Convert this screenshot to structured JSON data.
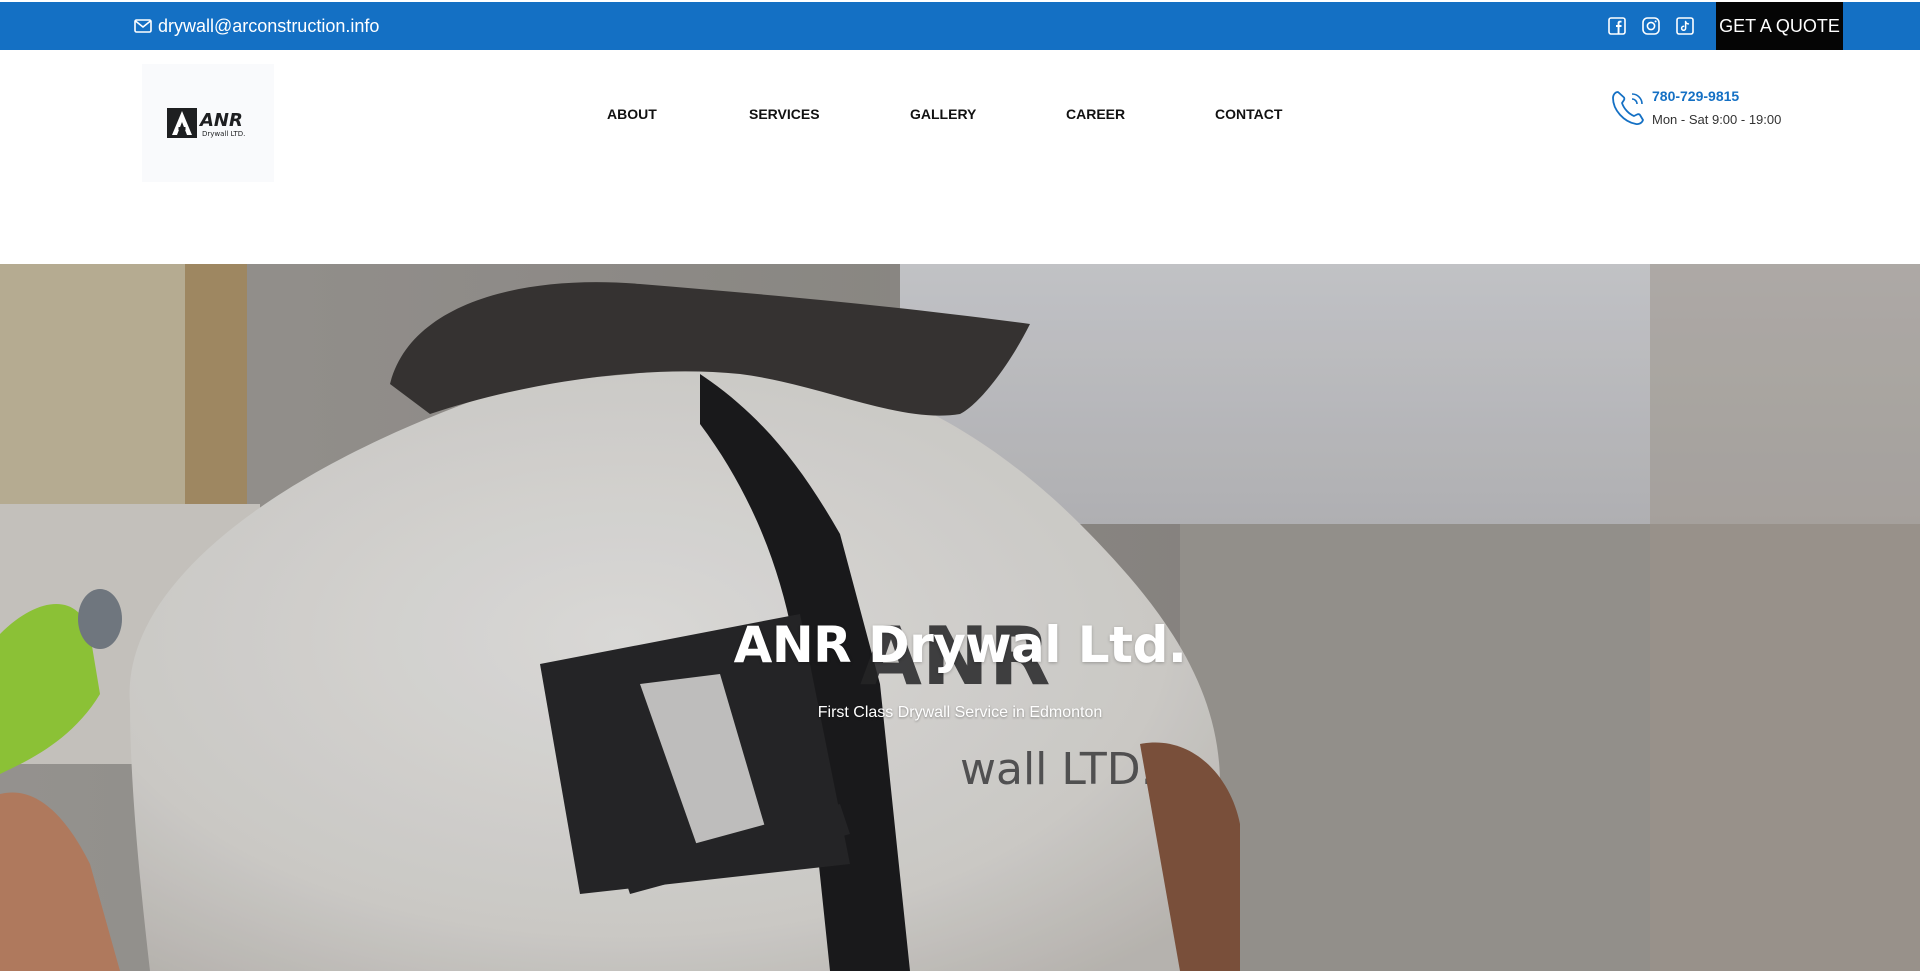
{
  "topbar": {
    "email": "drywall@arconstruction.info",
    "quote_label": "GET A QUOTE",
    "socials": [
      "facebook-icon",
      "instagram-icon",
      "tiktok-icon"
    ]
  },
  "header": {
    "logo_text": "ANR",
    "logo_sub": "Drywall LTD.",
    "nav": [
      {
        "label": "ABOUT"
      },
      {
        "label": "SERVICES"
      },
      {
        "label": "GALLERY"
      },
      {
        "label": "CAREER"
      },
      {
        "label": "CONTACT"
      }
    ],
    "phone": "780-729-9815",
    "hours": "Mon - Sat 9:00 - 19:00"
  },
  "hero": {
    "title": "ANR Drywal Ltd.",
    "subtitle": "First Class Drywall Service in Edmonton",
    "shirt_logo_text": "ANR",
    "shirt_logo_sub": "wall LTD."
  },
  "colors": {
    "brand_blue": "#1470c4",
    "quote_bg": "#050505",
    "nav_text": "#111111"
  }
}
